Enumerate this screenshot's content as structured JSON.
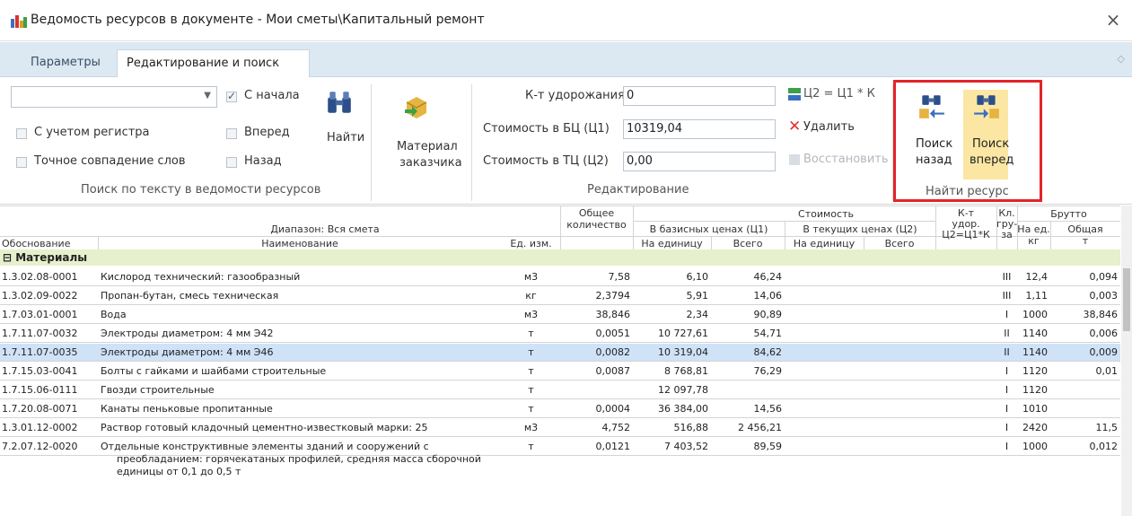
{
  "window": {
    "title": "Ведомость ресурсов в документе - Мои сметы\\Капитальный ремонт",
    "close": "×"
  },
  "tabs": [
    "Параметры",
    "Редактирование и поиск"
  ],
  "search_group": {
    "combo_value": "",
    "from_start": "С начала",
    "forward": "Вперед",
    "back": "Назад",
    "case": "С учетом регистра",
    "exact": "Точное совпадение слов",
    "find": "Найти",
    "label": "Поиск по тексту в ведомости ресурсов"
  },
  "material": {
    "line1": "Материал",
    "line2": "заказчика"
  },
  "edit_group": {
    "coef_label": "К-т удорожания",
    "coef_value": "0",
    "bc_label": "Стоимость в БЦ (Ц1)",
    "bc_value": "10319,04",
    "tc_label": "Стоимость в ТЦ (Ц2)",
    "tc_value": "0,00",
    "formula": "Ц2 = Ц1 * К",
    "delete": "Удалить",
    "restore": "Восстановить",
    "label": "Редактирование"
  },
  "find_group": {
    "back_1": "Поиск",
    "back_2": "назад",
    "fwd_1": "Поиск",
    "fwd_2": "вперед",
    "label": "Найти ресурс"
  },
  "grid": {
    "range": "Диапазон: Вся смета",
    "h_total_1": "Общее",
    "h_total_2": "количество",
    "h_cost": "Стоимость",
    "h_base": "В базисных ценах (Ц1)",
    "h_current": "В текущих ценах (Ц2)",
    "h_per_unit": "На единицу",
    "h_all": "Всего",
    "h_per_unit2": "На единицу",
    "h_all2": "Всего",
    "h_kt1": "К-т",
    "h_kt2": "удор.",
    "h_kt3": "Ц2=Ц1*К",
    "h_kl1": "Кл.",
    "h_kl2": "гру-",
    "h_kl3": "за",
    "h_brutto": "Брутто",
    "h_na_ed": "На ед.",
    "h_kg": "кг",
    "h_obsh": "Общая",
    "h_t": "т",
    "h_basis": "Обоснование",
    "h_name": "Наименование",
    "h_unit": "Ед. изм.",
    "group": "Материалы",
    "rows": [
      {
        "code": "1.3.02.08-0001",
        "name": "Кислород технический: газообразный",
        "unit": "м3",
        "qty": "7,58",
        "base_unit": "6,10",
        "base_all": "46,24",
        "kl": "III",
        "per": "12,4",
        "tot": "0,094"
      },
      {
        "code": "1.3.02.09-0022",
        "name": "Пропан-бутан, смесь техническая",
        "unit": "кг",
        "qty": "2,3794",
        "base_unit": "5,91",
        "base_all": "14,06",
        "kl": "III",
        "per": "1,11",
        "tot": "0,003"
      },
      {
        "code": "1.7.03.01-0001",
        "name": "Вода",
        "unit": "м3",
        "qty": "38,846",
        "base_unit": "2,34",
        "base_all": "90,89",
        "kl": "I",
        "per": "1000",
        "tot": "38,846"
      },
      {
        "code": "1.7.11.07-0032",
        "name": "Электроды диаметром: 4 мм Э42",
        "unit": "т",
        "qty": "0,0051",
        "base_unit": "10 727,61",
        "base_all": "54,71",
        "kl": "II",
        "per": "1140",
        "tot": "0,006"
      },
      {
        "code": "1.7.11.07-0035",
        "name": "Электроды диаметром: 4 мм Э46",
        "unit": "т",
        "qty": "0,0082",
        "base_unit": "10 319,04",
        "base_all": "84,62",
        "kl": "II",
        "per": "1140",
        "tot": "0,009"
      },
      {
        "code": "1.7.15.03-0041",
        "name": "Болты с гайками и шайбами строительные",
        "unit": "т",
        "qty": "0,0087",
        "base_unit": "8 768,81",
        "base_all": "76,29",
        "kl": "I",
        "per": "1120",
        "tot": "0,01"
      },
      {
        "code": "1.7.15.06-0111",
        "name": "Гвозди строительные",
        "unit": "т",
        "qty": "",
        "base_unit": "12 097,78",
        "base_all": "",
        "kl": "I",
        "per": "1120",
        "tot": ""
      },
      {
        "code": "1.7.20.08-0071",
        "name": "Канаты пеньковые пропитанные",
        "unit": "т",
        "qty": "0,0004",
        "base_unit": "36 384,00",
        "base_all": "14,56",
        "kl": "I",
        "per": "1010",
        "tot": ""
      },
      {
        "code": "1.3.01.12-0002",
        "name": "Раствор готовый кладочный цементно-известковый марки: 25",
        "unit": "м3",
        "qty": "4,752",
        "base_unit": "516,88",
        "base_all": "2 456,21",
        "kl": "I",
        "per": "2420",
        "tot": "11,5"
      },
      {
        "code": "7.2.07.12-0020",
        "name": "Отдельные конструктивные элементы зданий и сооружений с",
        "name2": "преобладанием: горячекатаных профилей, средняя масса сборочной",
        "name3": "единицы от 0,1 до 0,5 т",
        "unit": "т",
        "qty": "0,0121",
        "base_unit": "7 403,52",
        "base_all": "89,59",
        "kl": "I",
        "per": "1000",
        "tot": "0,012"
      }
    ]
  },
  "colors": {
    "accent": "#e2242a",
    "tab_bg": "#dce8f2",
    "selected_row": "#cfe2f8",
    "group_row": "#e6f0cc"
  }
}
